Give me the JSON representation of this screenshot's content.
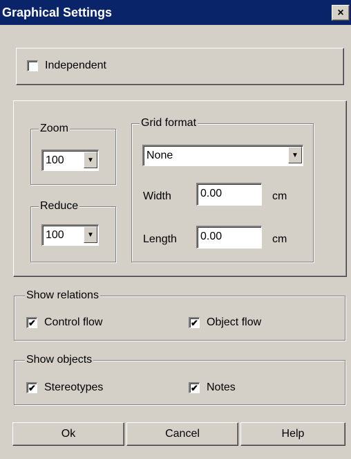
{
  "window": {
    "title": "Graphical Settings",
    "close_label": "×"
  },
  "independent": {
    "label": "Independent",
    "checked": false
  },
  "zoom": {
    "label": "Zoom",
    "value": "100"
  },
  "reduce": {
    "label": "Reduce",
    "value": "100"
  },
  "grid": {
    "label": "Grid format",
    "format_value": "None",
    "width_label": "Width",
    "width_value": "0.00",
    "width_unit": "cm",
    "length_label": "Length",
    "length_value": "0.00",
    "length_unit": "cm"
  },
  "relations": {
    "label": "Show relations",
    "control_flow": {
      "label": "Control flow",
      "checked": true
    },
    "object_flow": {
      "label": "Object flow",
      "checked": true
    }
  },
  "objects": {
    "label": "Show objects",
    "stereotypes": {
      "label": "Stereotypes",
      "checked": true
    },
    "notes": {
      "label": "Notes",
      "checked": true
    }
  },
  "buttons": {
    "ok": "Ok",
    "cancel": "Cancel",
    "help": "Help"
  },
  "icons": {
    "check": "✔",
    "dropdown": "▼"
  }
}
